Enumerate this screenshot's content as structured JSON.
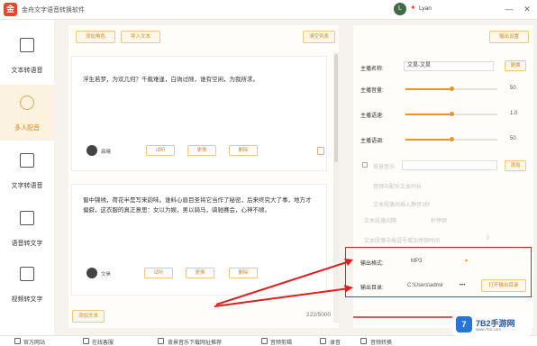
{
  "titlebar": {
    "app_title": "金舟文字语音转换软件",
    "logo_glyph": "金",
    "avatar_glyph": "L",
    "user_name": "Lyan",
    "minimize": "—",
    "close": "✕"
  },
  "sidebar": {
    "items": [
      {
        "label": "文本转语音"
      },
      {
        "label": "多人配音"
      },
      {
        "label": "文字转语音"
      },
      {
        "label": "语音转文字"
      },
      {
        "label": "视频转文字"
      }
    ]
  },
  "toolbar": {
    "add_role": "添加角色",
    "import_text": "导入文本",
    "clear_list": "清空列表",
    "output_settings": "输出设置"
  },
  "blocks": [
    {
      "text": "浮生若梦，为欢几何？千载难逢，白驹过隙，谁有空闲，为我所求。",
      "voice": "晨曦",
      "play": "试听",
      "change": "更换",
      "delete": "删除"
    },
    {
      "text": "蜀中锦绣，荷花半是写来韵味。谁料心眉目圣将它当作了秘密，后来终究大了事，地方才偏僻，这衣服的真正意思：女以为娱，男以骑马，骑驰赛会，心神不顺。",
      "voice": "文昊",
      "play": "试听",
      "change": "更换",
      "delete": "删除"
    }
  ],
  "footer": {
    "add_text": "添加文本",
    "counter": "222/5000"
  },
  "settings": {
    "role_name_label": "主播名称:",
    "role_name_value": "文昊-文昊",
    "change_btn": "更换",
    "volume_label": "主播音量:",
    "volume_value": "50",
    "volume": 0.5,
    "speed_label": "主播语速:",
    "speed_value": "1.0",
    "speed": 0.5,
    "pitch_label": "主播语调:",
    "pitch_value": "50",
    "pitch": 0.5,
    "bgm_label": "背景音乐",
    "bgm_add": "添加",
    "opt1": "音频与配乐文本同长",
    "opt2": "文本段落间插入静音3秒",
    "opt3": "文本段落间隔",
    "opt3_tail": "秒停顿",
    "opt4": "文本段落中按逗号增加停顿时间",
    "opt4_val": "0",
    "format_label": "输出格式:",
    "format_value": "MP3",
    "dir_label": "输出目录:",
    "dir_value": "C:\\Users\\admir",
    "dir_more": "•••",
    "open_dir": "打开输出目录"
  },
  "bottombar": {
    "items": [
      "官方网站",
      "在线客服",
      "背景音乐下载网址推荐",
      "音频剪辑",
      "录音",
      "音频转换"
    ]
  },
  "watermark": {
    "logo": "7",
    "text": "7B2手游网",
    "url": "www.7b2.com"
  },
  "colors": {
    "accent": "#e9952b",
    "annotation": "#e21d1d"
  }
}
